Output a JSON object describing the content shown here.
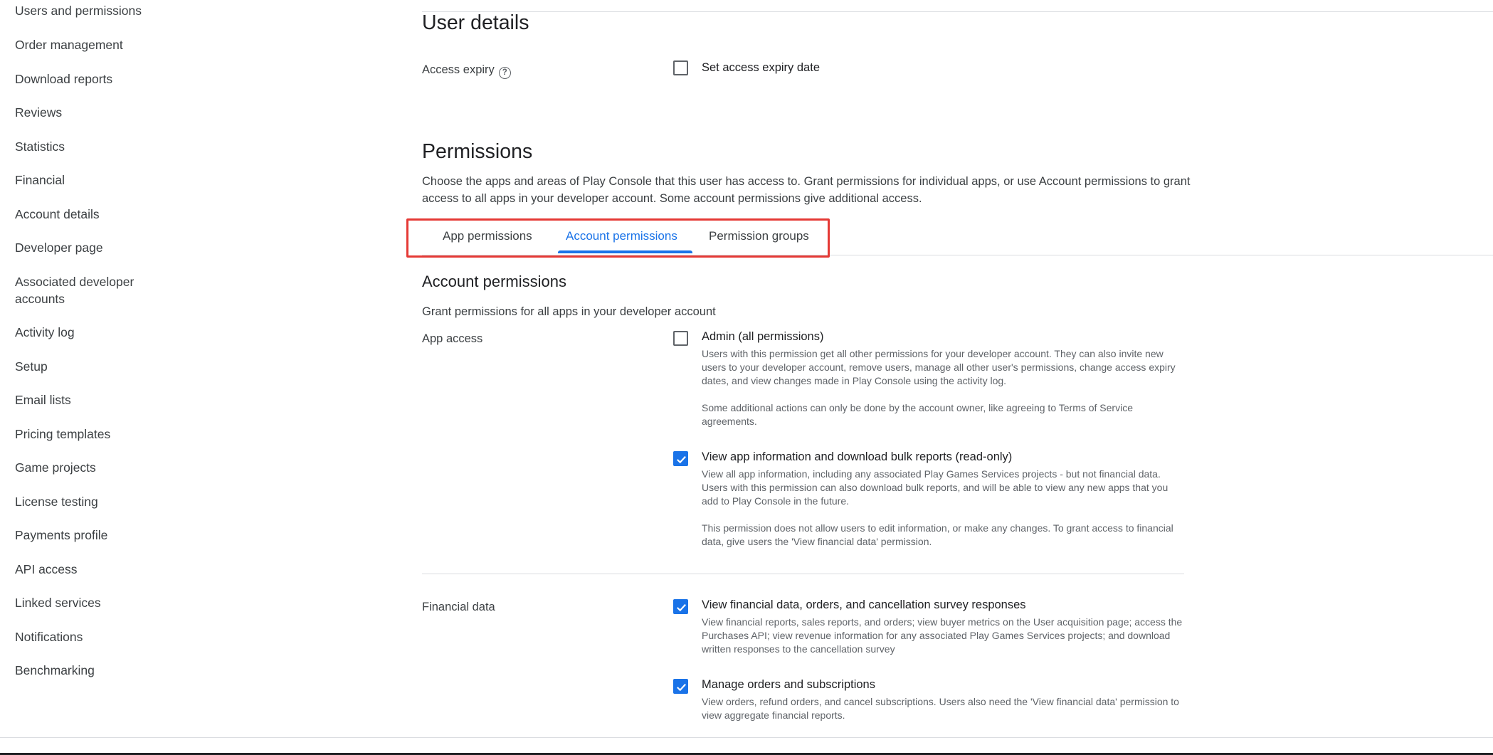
{
  "sidebar": {
    "items": [
      {
        "label": "Users and permissions"
      },
      {
        "label": "Order management"
      },
      {
        "label": "Download reports"
      },
      {
        "label": "Reviews"
      },
      {
        "label": "Statistics"
      },
      {
        "label": "Financial"
      },
      {
        "label": "Account details"
      },
      {
        "label": "Developer page"
      },
      {
        "label": "Associated developer accounts"
      },
      {
        "label": "Activity log"
      },
      {
        "label": "Setup"
      },
      {
        "label": "Email lists"
      },
      {
        "label": "Pricing templates"
      },
      {
        "label": "Game projects"
      },
      {
        "label": "License testing"
      },
      {
        "label": "Payments profile"
      },
      {
        "label": "API access"
      },
      {
        "label": "Linked services"
      },
      {
        "label": "Notifications"
      },
      {
        "label": "Benchmarking"
      }
    ]
  },
  "user_details": {
    "title": "User details",
    "access_expiry_label": "Access expiry",
    "help_glyph": "?",
    "set_expiry_label": "Set access expiry date",
    "set_expiry_checked": false
  },
  "permissions": {
    "title": "Permissions",
    "description": "Choose the apps and areas of Play Console that this user has access to. Grant permissions for individual apps, or use Account permissions to grant access to all apps in your developer account. Some account permissions give additional access.",
    "tabs": [
      {
        "label": "App permissions",
        "active": false
      },
      {
        "label": "Account permissions",
        "active": true
      },
      {
        "label": "Permission groups",
        "active": false
      }
    ],
    "highlight_color": "#e53935",
    "accent_color": "#1a73e8"
  },
  "account_permissions": {
    "title": "Account permissions",
    "subtitle": "Grant permissions for all apps in your developer account",
    "app_access": {
      "label": "App access",
      "options": [
        {
          "title": "Admin (all permissions)",
          "checked": false,
          "desc1": "Users with this permission get all other permissions for your developer account. They can also invite new users to your developer account, remove users, manage all other user's permissions, change access expiry dates, and view changes made in Play Console using the activity log.",
          "desc2": "Some additional actions can only be done by the account owner, like agreeing to Terms of Service agreements."
        },
        {
          "title": "View app information and download bulk reports (read-only)",
          "checked": true,
          "desc1": "View all app information, including any associated Play Games Services projects - but not financial data. Users with this permission can also download bulk reports, and will be able to view any new apps that you add to Play Console in the future.",
          "desc2": "This permission does not allow users to edit information, or make any changes. To grant access to financial data, give users the 'View financial data' permission."
        }
      ]
    },
    "financial_data": {
      "label": "Financial data",
      "options": [
        {
          "title": "View financial data, orders, and cancellation survey responses",
          "checked": true,
          "desc1": "View financial reports, sales reports, and orders; view buyer metrics on the User acquisition page; access the Purchases API; view revenue information for any associated Play Games Services projects; and download written responses to the cancellation survey"
        },
        {
          "title": "Manage orders and subscriptions",
          "checked": true,
          "desc1": "View orders, refund orders, and cancel subscriptions. Users also need the 'View financial data' permission to view aggregate financial reports."
        }
      ]
    }
  }
}
